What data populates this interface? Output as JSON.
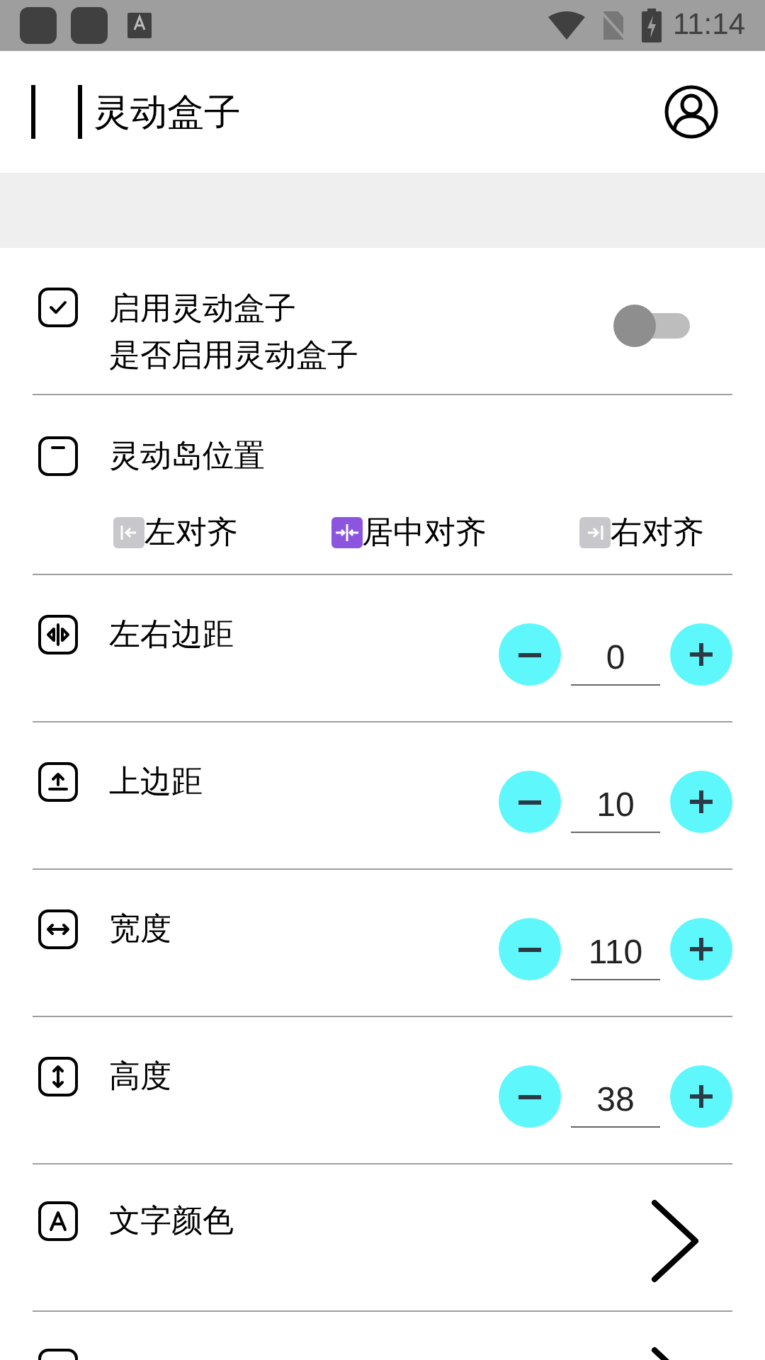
{
  "status_bar": {
    "time": "11:14"
  },
  "app_bar": {
    "title": "灵动盒子"
  },
  "settings": [
    {
      "kind": "switch",
      "title": "启用灵动盒子",
      "subtitle": "是否启用灵动盒子",
      "on": false
    },
    {
      "kind": "choice",
      "title": "灵动岛位置",
      "options": [
        {
          "label": "左对齐",
          "selected": false
        },
        {
          "label": "居中对齐",
          "selected": true
        },
        {
          "label": "右对齐",
          "selected": false
        }
      ]
    },
    {
      "kind": "stepper",
      "title": "左右边距",
      "value": "0"
    },
    {
      "kind": "stepper",
      "title": "上边距",
      "value": "10"
    },
    {
      "kind": "stepper",
      "title": "宽度",
      "value": "110"
    },
    {
      "kind": "stepper",
      "title": "高度",
      "value": "38"
    },
    {
      "kind": "link",
      "title": "文字颜色"
    },
    {
      "kind": "link"
    }
  ]
}
